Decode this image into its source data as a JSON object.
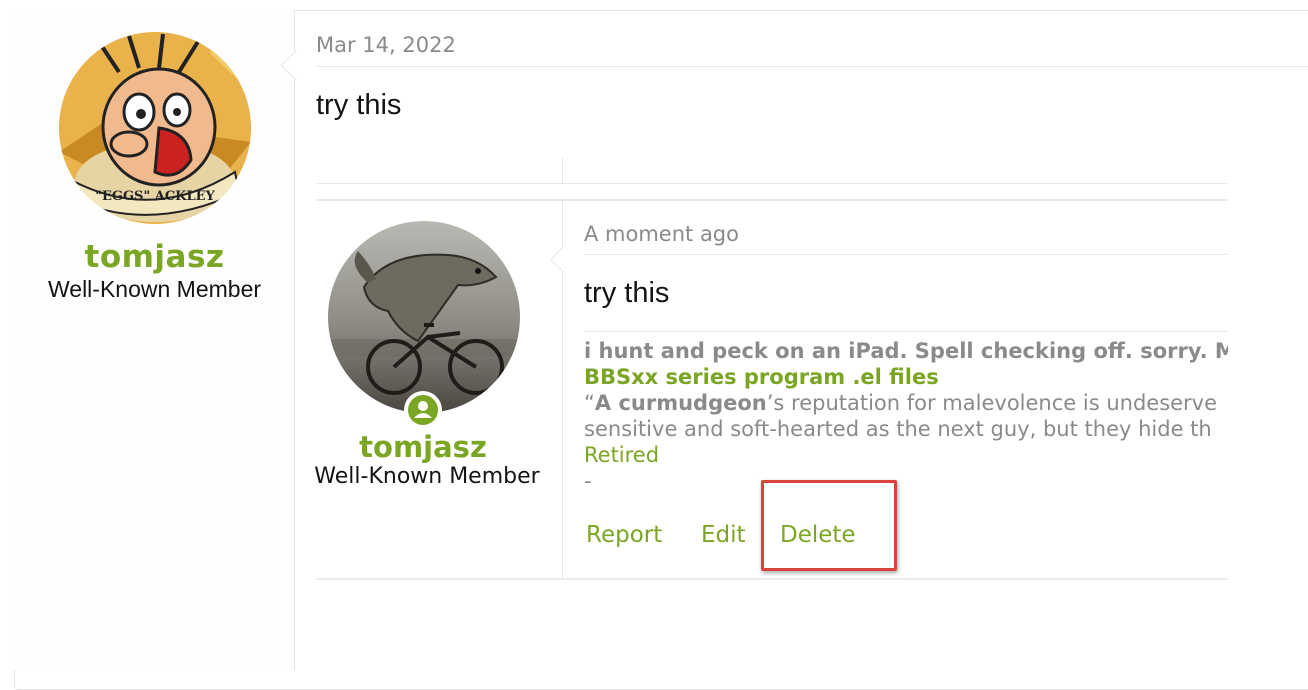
{
  "outer_post": {
    "user": {
      "name": "tomjasz",
      "title": "Well-Known Member",
      "avatar": "avatar-eggs-ackley-icon",
      "avatar_caption": "\"EGGS\" ACKLEY"
    },
    "date": "Mar 14, 2022",
    "message": "try this"
  },
  "quoted_post": {
    "user": {
      "name": "tomjasz",
      "title": "Well-Known Member",
      "avatar": "avatar-fish-on-bicycle-icon",
      "online_icon": "user-online-icon"
    },
    "date": "A moment ago",
    "message": "try this",
    "signature": {
      "line1": "i hunt and peck on an iPad. Spell checking off. sorry. M",
      "link": "BBSxx series program .el files",
      "quote_open": "“",
      "quote_bold": "A curmudgeon",
      "quote_rest": "’s reputation for malevolence is undeserve",
      "line4": "sensitive and soft-hearted as the next guy, but they hide th",
      "retired": "Retired",
      "dash": "-"
    },
    "actions": {
      "report": "Report",
      "edit": "Edit",
      "delete": "Delete"
    }
  },
  "colors": {
    "accent": "#7aa624",
    "muted": "#8a8a8a",
    "highlight": "#d9433b"
  }
}
